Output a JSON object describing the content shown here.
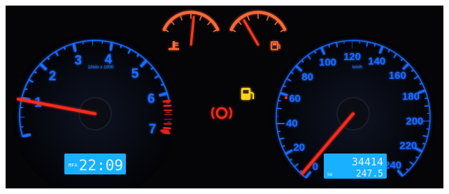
{
  "tachometer": {
    "unit_label": "1/min x 1000",
    "scale_labels": [
      "1",
      "2",
      "3",
      "4",
      "5",
      "6",
      "7"
    ],
    "needle_value": 0.9,
    "lcd": {
      "mode": "MFA",
      "time": "22:09"
    }
  },
  "speedometer": {
    "unit_label": "km/h",
    "scale_labels": [
      "0",
      "20",
      "40",
      "60",
      "80",
      "100",
      "120",
      "140",
      "160",
      "180",
      "200",
      "220",
      "240"
    ],
    "needle_value": 2,
    "lcd": {
      "odometer": "34414",
      "trip": "247.5",
      "trip_unit": "km"
    }
  },
  "gauges": {
    "coolant": {
      "icon": "coolant-temperature-icon",
      "level": 0.55
    },
    "fuel": {
      "icon": "fuel-pump-icon",
      "level": 0.25
    }
  },
  "warning_lights": [
    {
      "name": "fuel-warning-icon",
      "color": "#ffd21a",
      "active": true
    },
    {
      "name": "brake-warning-icon",
      "color": "#ff2a1a",
      "active": true
    }
  ],
  "colors": {
    "backlight": "#1e6bff",
    "needle": "#ff2a1a",
    "redline": "#e0201a",
    "lcd": "#19b0ff",
    "lcd_text": "#dff4ff",
    "small_gauge": "#ff6a3a"
  }
}
